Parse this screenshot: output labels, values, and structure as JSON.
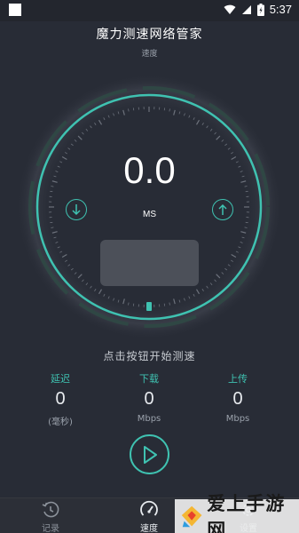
{
  "status_bar": {
    "time": "5:37",
    "battery_label": "⚡"
  },
  "header": {
    "title": "魔力测速网络管家",
    "subtitle": "速度"
  },
  "gauge": {
    "speed_value": "0.0",
    "unit": "MS",
    "progress": 0
  },
  "hint": "点击按钮开始测速",
  "metrics": [
    {
      "label": "延迟",
      "value": "0",
      "unit": "(毫秒)"
    },
    {
      "label": "下载",
      "value": "0",
      "unit": "Mbps"
    },
    {
      "label": "上传",
      "value": "0",
      "unit": "Mbps"
    }
  ],
  "nav": [
    {
      "label": "记录",
      "icon": "history-icon"
    },
    {
      "label": "速度",
      "icon": "speedometer-icon",
      "active": true
    },
    {
      "label": "设置",
      "icon": "gear-icon"
    }
  ],
  "watermark": {
    "text": "爱上手游网"
  },
  "colors": {
    "accent": "#3fc2b1",
    "background": "#282c36"
  }
}
